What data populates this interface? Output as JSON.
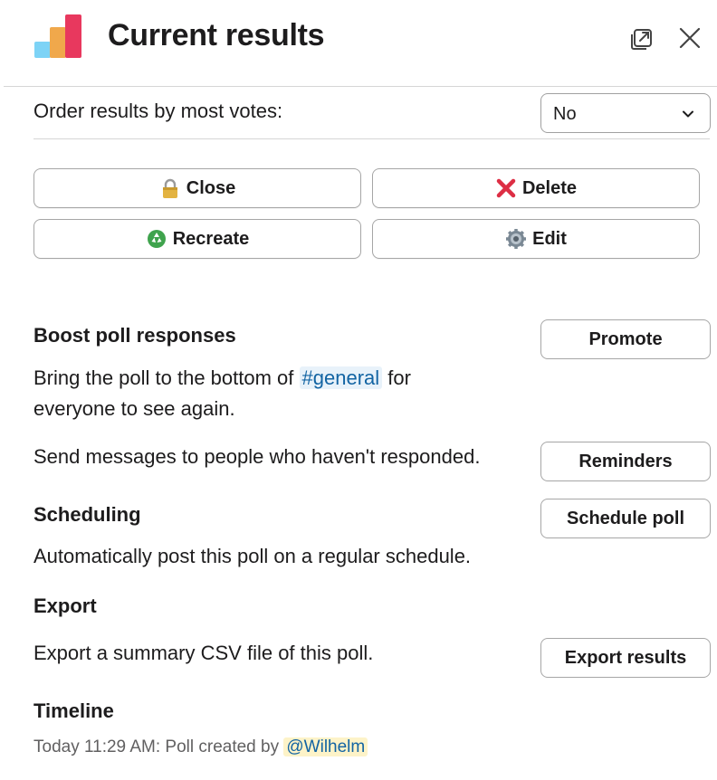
{
  "header": {
    "title": "Current results",
    "logo_colors": [
      "#7dd3f6",
      "#f0a84b",
      "#e8385e"
    ],
    "icons": [
      "popout-icon",
      "close-icon"
    ]
  },
  "order": {
    "label": "Order results by most votes:",
    "selected": "No"
  },
  "actions": {
    "close": {
      "label": "Close",
      "icon": "lock-icon"
    },
    "delete": {
      "label": "Delete",
      "icon": "cross-mark-icon"
    },
    "recreate": {
      "label": "Recreate",
      "icon": "recycle-icon"
    },
    "edit": {
      "label": "Edit",
      "icon": "gear-icon"
    }
  },
  "boost": {
    "title": "Boost poll responses",
    "text_before": "Bring the poll to the bottom of ",
    "channel": "#general",
    "text_after": " for",
    "text_line2": "everyone to see again.",
    "promote_label": "Promote",
    "reminders_text": "Send messages to people who haven't responded.",
    "reminders_label": "Reminders"
  },
  "scheduling": {
    "title": "Scheduling",
    "text": "Automatically post this poll on a regular schedule.",
    "button_label": "Schedule poll"
  },
  "export": {
    "title": "Export",
    "text": "Export a summary CSV file of this poll.",
    "button_label": "Export results"
  },
  "timeline": {
    "title": "Timeline",
    "entry_prefix": "Today 11:29 AM: Poll created by ",
    "mention": "@Wilhelm"
  },
  "colors": {
    "link": "#1264a3",
    "channel_bg": "#e8f2fa",
    "mention_bg": "#fdf3c8"
  }
}
